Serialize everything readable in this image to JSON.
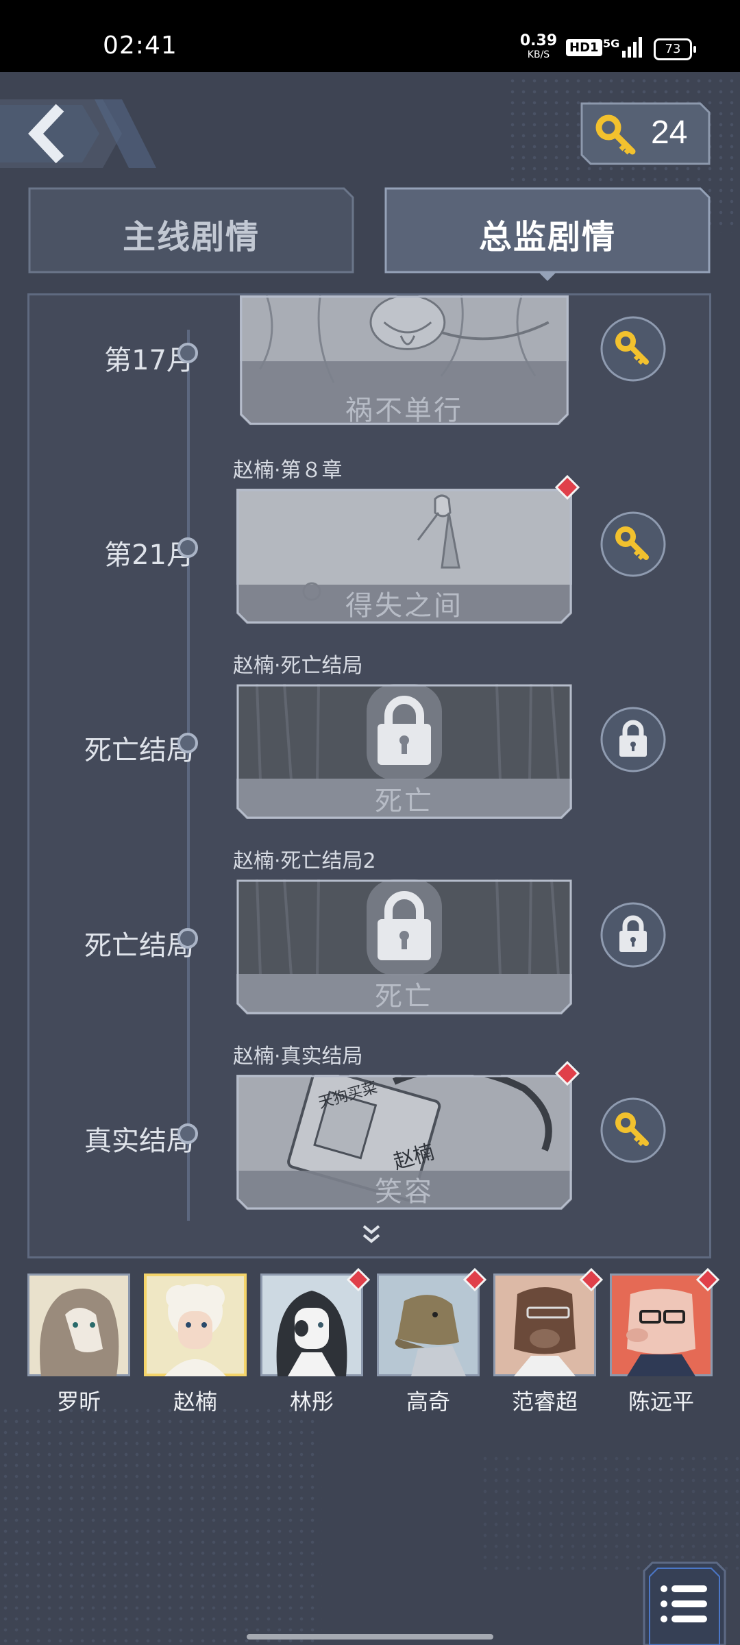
{
  "status_bar": {
    "time": "02:41",
    "speed_value": "0.39",
    "speed_unit": "KB/S",
    "hd": "HD1",
    "network": "5G",
    "battery": "73"
  },
  "header": {
    "key_count": "24"
  },
  "tabs": [
    {
      "label": "主线剧情",
      "selected": false
    },
    {
      "label": "总监剧情",
      "selected": true
    }
  ],
  "timeline": [
    {
      "label": "第17月",
      "caption": "",
      "title": "祸不单行",
      "status": "unlocked",
      "new": false
    },
    {
      "label": "第21月",
      "caption": "赵楠·第８章",
      "title": "得失之间",
      "status": "unlocked",
      "new": true
    },
    {
      "label": "死亡结局",
      "caption": "赵楠·死亡结局",
      "title": "死亡",
      "status": "locked",
      "new": false
    },
    {
      "label": "死亡结局",
      "caption": "赵楠·死亡结局2",
      "title": "死亡",
      "status": "locked",
      "new": false
    },
    {
      "label": "真实结局",
      "caption": "赵楠·真实结局",
      "title": "笑容",
      "status": "unlocked",
      "new": true,
      "badge_text_1": "天狗买菜",
      "badge_text_2": "赵楠"
    }
  ],
  "characters": [
    {
      "name": "罗昕",
      "selected": false,
      "new": false
    },
    {
      "name": "赵楠",
      "selected": true,
      "new": false
    },
    {
      "name": "林彤",
      "selected": false,
      "new": true
    },
    {
      "name": "高奇",
      "selected": false,
      "new": true
    },
    {
      "name": "范睿超",
      "selected": false,
      "new": true
    },
    {
      "name": "陈远平",
      "selected": false,
      "new": true
    }
  ],
  "colors": {
    "background": "#3e4453",
    "panel": "#444a5a",
    "accent_key": "#f2c12e",
    "new_marker": "#e0404a",
    "selected_frame": "#f4d46a"
  }
}
